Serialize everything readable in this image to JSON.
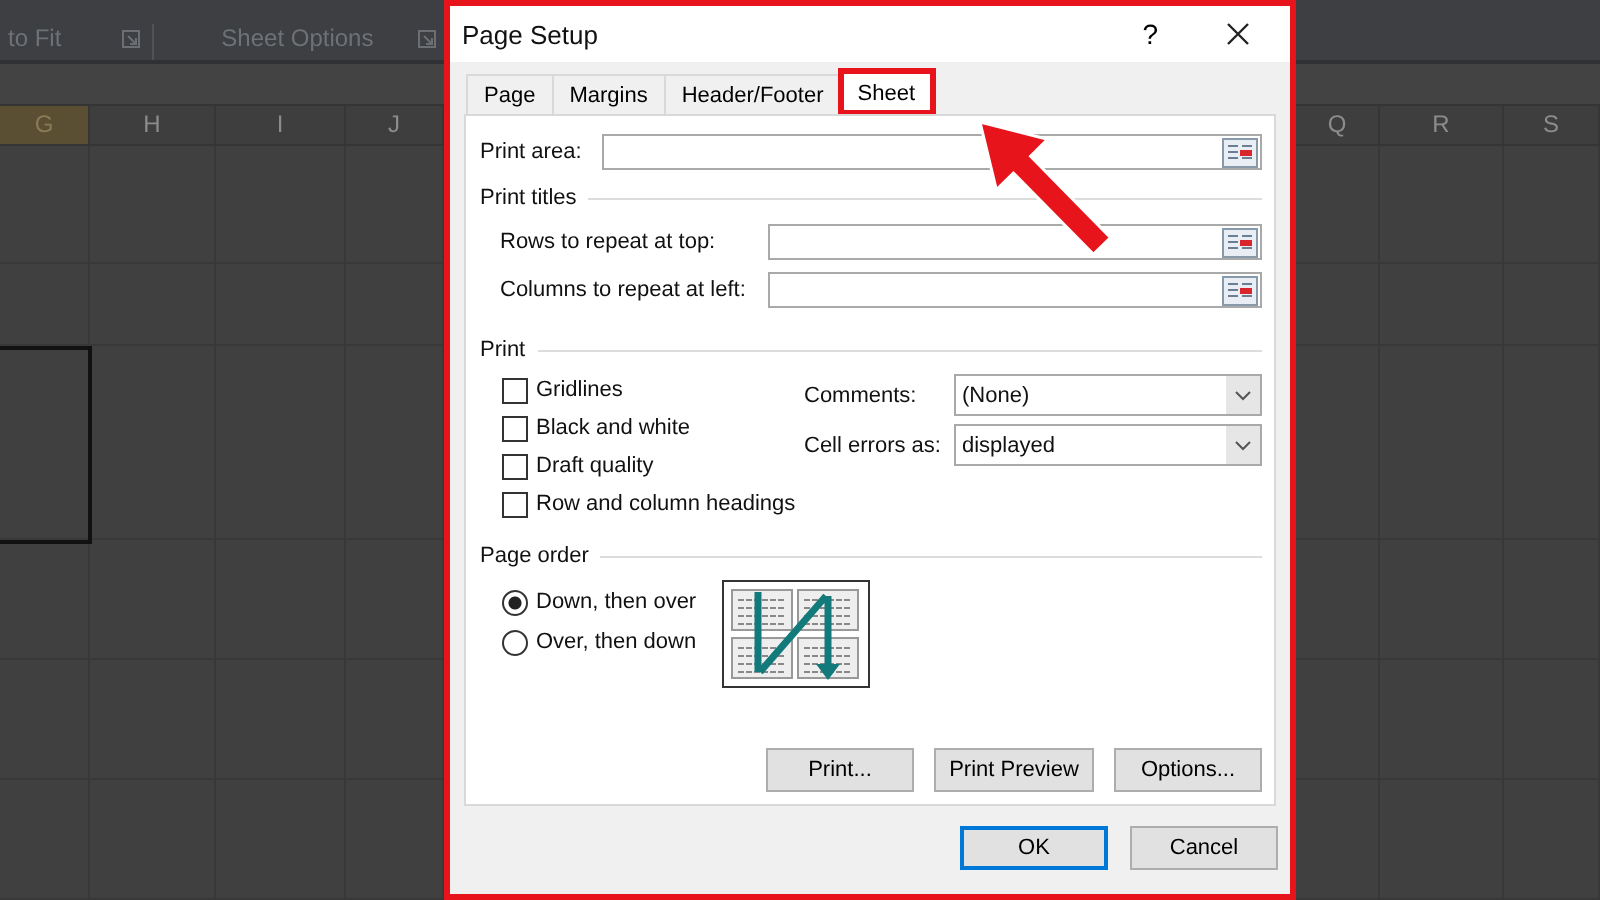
{
  "background": {
    "ribbon_groups": [
      {
        "label": "to Fit"
      },
      {
        "label": "Sheet Options"
      }
    ],
    "left_columns": [
      {
        "label": "G",
        "selected": true
      },
      {
        "label": "H",
        "selected": false
      },
      {
        "label": "I",
        "selected": false
      },
      {
        "label": "J",
        "selected": false
      }
    ],
    "right_columns": [
      {
        "label": "Q",
        "selected": false
      },
      {
        "label": "R",
        "selected": false
      },
      {
        "label": "S",
        "selected": false
      }
    ]
  },
  "dialog": {
    "title": "Page Setup",
    "help": "?",
    "tabs": [
      {
        "label": "Page",
        "selected": false,
        "highlighted": false
      },
      {
        "label": "Margins",
        "selected": false,
        "highlighted": false
      },
      {
        "label": "Header/Footer",
        "selected": false,
        "highlighted": false
      },
      {
        "label": "Sheet",
        "selected": true,
        "highlighted": true
      }
    ],
    "print_area": {
      "label": "Print area:"
    },
    "print_titles": {
      "heading": "Print titles",
      "fields": [
        {
          "label": "Rows to repeat at top:"
        },
        {
          "label": "Columns to repeat at left:"
        }
      ]
    },
    "print": {
      "heading": "Print",
      "options": [
        {
          "label": "Gridlines",
          "checked": false
        },
        {
          "label": "Black and white",
          "checked": false
        },
        {
          "label": "Draft quality",
          "checked": false
        },
        {
          "label": "Row and column headings",
          "checked": false
        }
      ],
      "dropdowns": [
        {
          "label": "Comments:",
          "value": "(None)"
        },
        {
          "label": "Cell errors as:",
          "value": "displayed"
        }
      ]
    },
    "page_order": {
      "heading": "Page order",
      "options": [
        {
          "label": "Down, then over",
          "selected": true
        },
        {
          "label": "Over, then down",
          "selected": false
        }
      ]
    },
    "action_buttons": [
      "Print...",
      "Print Preview",
      "Options..."
    ],
    "footer_buttons": [
      {
        "label": "OK",
        "default": true
      },
      {
        "label": "Cancel",
        "default": false
      }
    ]
  }
}
